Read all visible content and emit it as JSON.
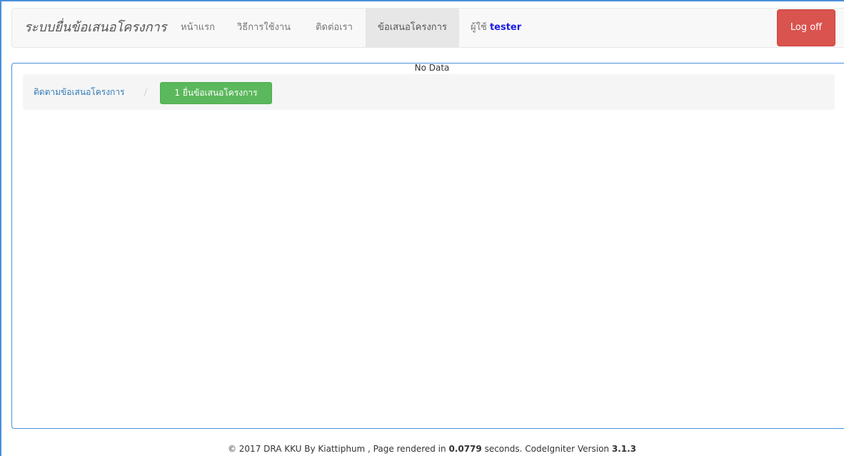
{
  "navbar": {
    "brand": "ระบบยื่นข้อเสนอโครงการ",
    "items": [
      {
        "label": "หน้าแรก"
      },
      {
        "label": "วิธีการใช้งาน"
      },
      {
        "label": "ติดต่อเรา"
      },
      {
        "label": "ข้อเสนอโครงการ",
        "active": true
      }
    ],
    "user_prefix": "ผู้ใช้",
    "user_name": "tester",
    "logoff_label": "Log off"
  },
  "breadcrumb": {
    "link_label": "ติดตามข้อเสนอโครงการ",
    "separator": "/",
    "button_label": "1 ยื่นข้อเสนอโครงการ"
  },
  "content": {
    "empty_message": "No Data"
  },
  "footer": {
    "prefix": "© 2017 DRA KKU By Kiattiphum , Page rendered in ",
    "render_time": "0.0779",
    "middle": " seconds. CodeIgniter Version ",
    "version": "3.1.3"
  },
  "colors": {
    "danger": "#d9534f",
    "success": "#5cb85c",
    "link": "#337ab7",
    "user_name": "#1a1ae6",
    "frame_border": "#4a90d9"
  }
}
